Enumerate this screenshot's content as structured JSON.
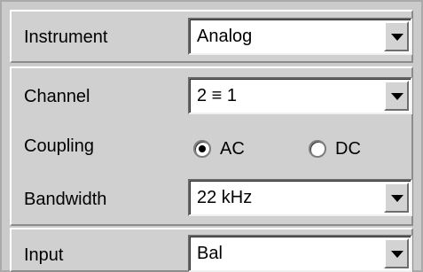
{
  "instrument": {
    "label": "Instrument",
    "value": "Analog"
  },
  "channel": {
    "label": "Channel",
    "value": "2 ≡ 1"
  },
  "coupling": {
    "label": "Coupling",
    "options": [
      {
        "label": "AC",
        "selected": true
      },
      {
        "label": "DC",
        "selected": false
      }
    ]
  },
  "bandwidth": {
    "label": "Bandwidth",
    "value": "22 kHz"
  },
  "input": {
    "label": "Input",
    "value": "Bal"
  },
  "icons": {
    "dropdown": "chevron-down-icon"
  },
  "colors": {
    "panel_background": "#d0d0d0",
    "field_background": "#ffffff"
  }
}
